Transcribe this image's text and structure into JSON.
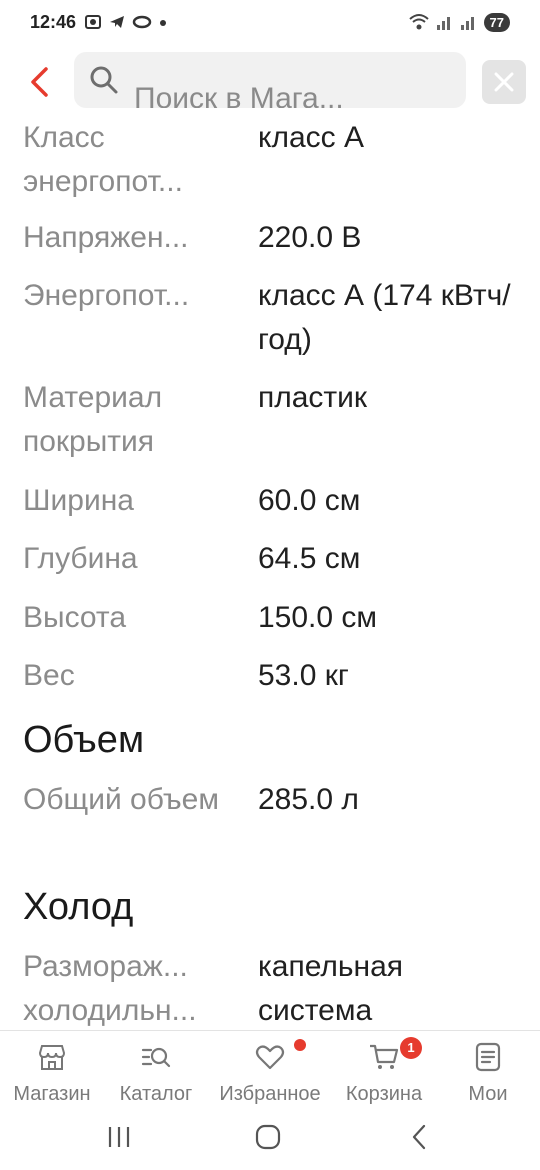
{
  "status_bar": {
    "time": "12:46",
    "battery": "77",
    "notification_icons": [
      "screenshot-icon",
      "telegram-icon",
      "link-icon",
      "dot-icon"
    ],
    "right_icons": [
      "wifi-icon",
      "signal-icon",
      "signal-icon"
    ]
  },
  "header": {
    "search_placeholder": "Поиск в Мага..."
  },
  "specs_top": [
    {
      "label": "Класс энергопот...",
      "value": "класс А"
    },
    {
      "label": "Напряжен...",
      "value": "220.0 В"
    },
    {
      "label": "Энергопот...",
      "value": "класс А (174 кВтч/год)"
    },
    {
      "label": "Материал покрытия",
      "value": "пластик"
    },
    {
      "label": "Ширина",
      "value": "60.0 см"
    },
    {
      "label": "Глубина",
      "value": "64.5 см"
    },
    {
      "label": "Высота",
      "value": "150.0 см"
    },
    {
      "label": "Вес",
      "value": "53.0 кг"
    }
  ],
  "section_volume": {
    "title": "Объем",
    "specs": [
      {
        "label": "Общий объем",
        "value": "285.0 л"
      }
    ]
  },
  "section_cold": {
    "title": "Холод",
    "specs": [
      {
        "label": "Разморaж... холодильн...",
        "value": "капельная система"
      }
    ]
  },
  "bottom_nav": {
    "items": [
      {
        "label": "Магазин",
        "icon": "store-icon"
      },
      {
        "label": "Каталог",
        "icon": "catalog-search-icon"
      },
      {
        "label": "Избранное",
        "icon": "heart-icon"
      },
      {
        "label": "Корзина",
        "icon": "cart-icon",
        "badge": "1"
      },
      {
        "label": "Мои",
        "icon": "orders-icon"
      }
    ]
  },
  "colors": {
    "accent": "#e63b2e",
    "label": "#8b8b8b",
    "value": "#202020"
  }
}
